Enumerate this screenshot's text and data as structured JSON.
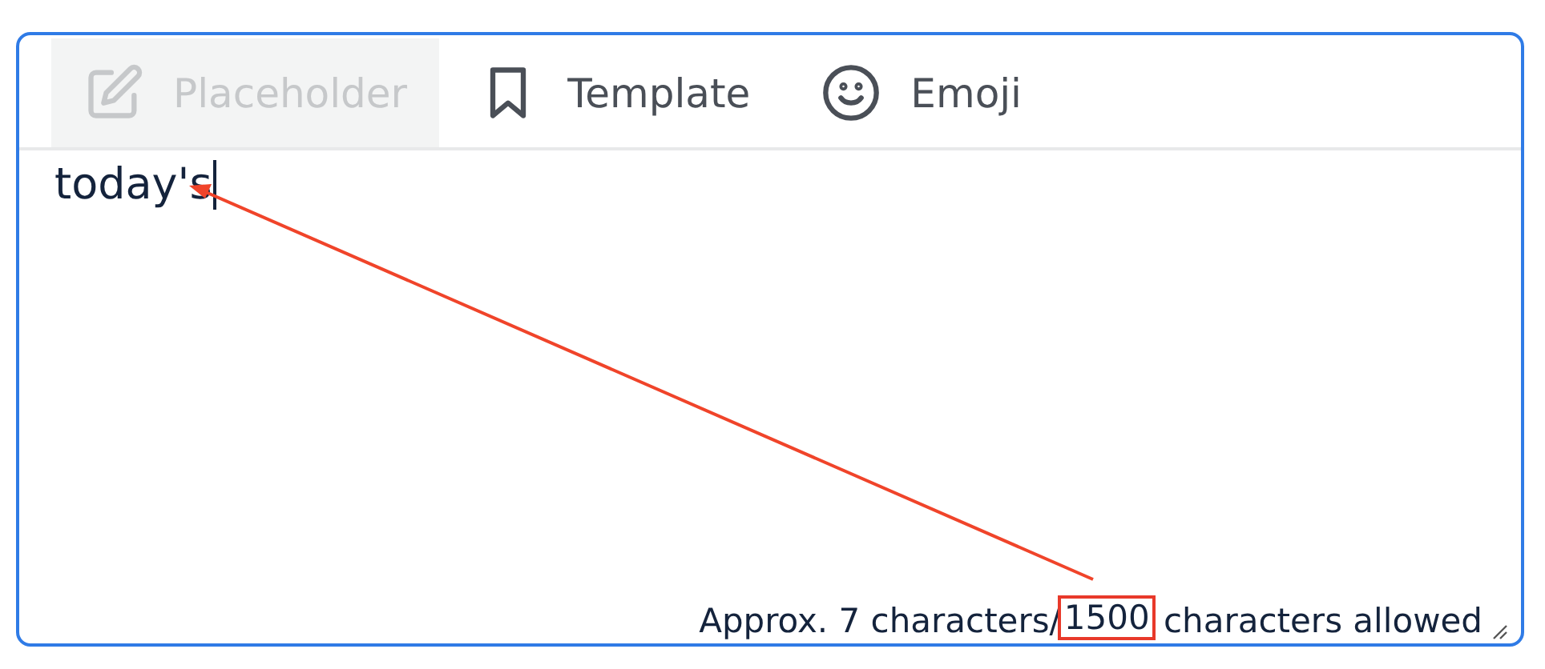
{
  "toolbar": [
    {
      "kind": "edit",
      "label": "Placeholder",
      "disabled": true
    },
    {
      "kind": "bookmark",
      "label": "Template",
      "disabled": false
    },
    {
      "kind": "smiley",
      "label": "Emoji",
      "disabled": false
    }
  ],
  "editor": {
    "value": "today's"
  },
  "counter": {
    "prefix": "Approx. 7 characters/",
    "limit": "1500",
    "suffix": " characters allowed"
  }
}
